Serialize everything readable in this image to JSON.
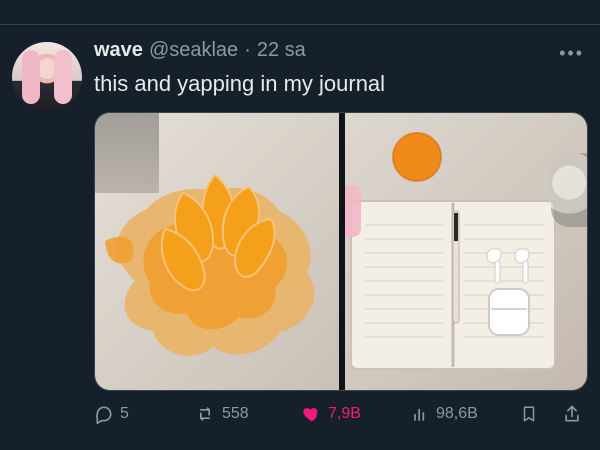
{
  "colors": {
    "background": "#15202b",
    "text_primary": "#e7e9ea",
    "text_secondary": "#8b98a5",
    "like": "#f91880",
    "border": "#38444d"
  },
  "tweet": {
    "display_name": "wave",
    "handle": "@seaklae",
    "dot": "·",
    "timestamp": "22 sa",
    "text": "this and yapping in my journal",
    "stats": {
      "replies": "5",
      "reposts": "558",
      "likes": "7,9B",
      "views": "98,6B"
    },
    "icons": {
      "more": "more-icon",
      "reply": "reply-icon",
      "repost": "repost-icon",
      "like": "heart-icon",
      "views": "analytics-icon",
      "bookmark": "bookmark-icon",
      "share": "share-icon"
    }
  }
}
